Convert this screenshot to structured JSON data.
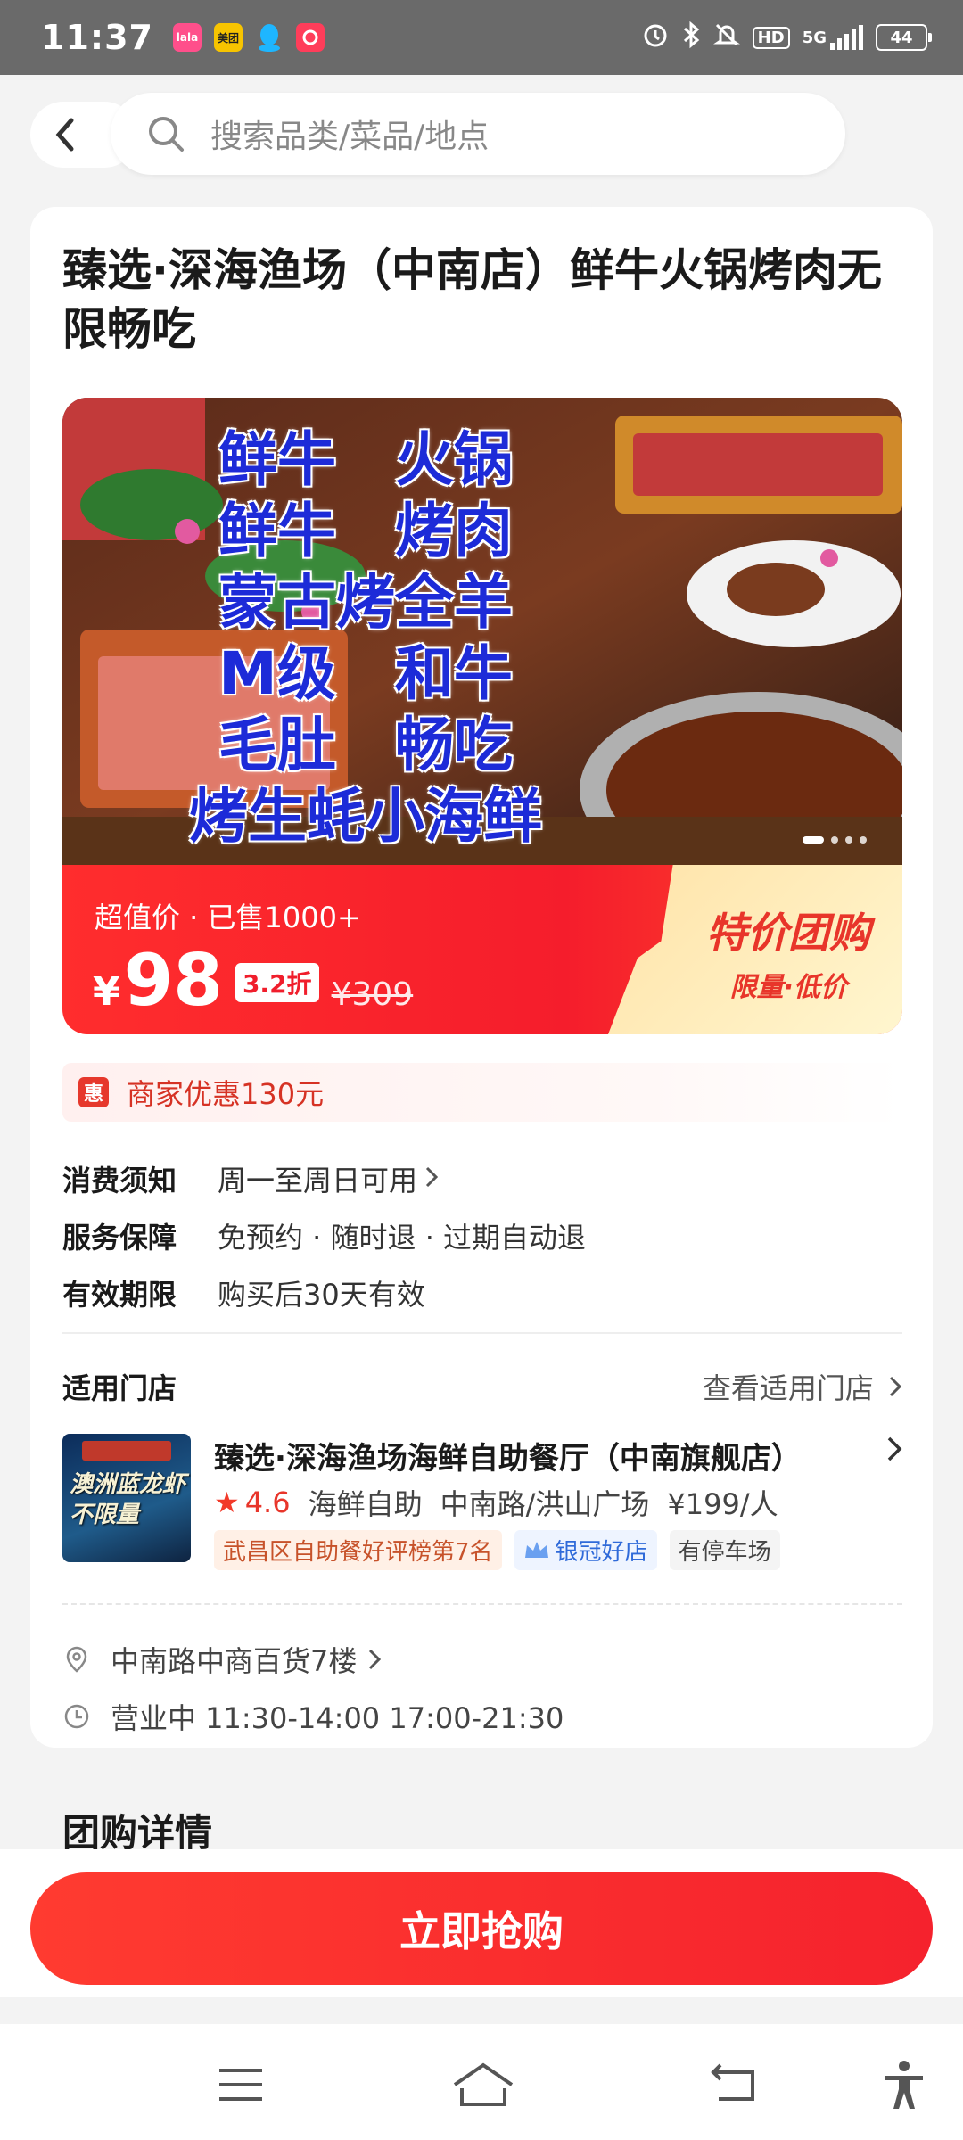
{
  "status_bar": {
    "time": "11:37",
    "notifications": [
      {
        "name": "lala",
        "label": "lala",
        "color": "#ff4f8b"
      },
      {
        "name": "meituan",
        "label": "美团",
        "color": "#f7c400"
      },
      {
        "name": "qq",
        "label": "",
        "color": "#1eb6ff"
      },
      {
        "name": "app",
        "label": "",
        "color": "#ff3d5a"
      }
    ],
    "hd": "HD",
    "network": "5G",
    "battery": "44"
  },
  "search": {
    "placeholder": "搜索品类/菜品/地点"
  },
  "deal": {
    "title": "臻选·深海渔场（中南店）鲜牛火锅烤肉无限畅吃",
    "hero_lines": [
      "鲜牛　火锅",
      "鲜牛　烤肉",
      "蒙古烤全羊",
      "M级　和牛",
      "毛肚　畅吃",
      "烤生蚝小海鲜"
    ],
    "price_tag": "超值价 · 已售1000+",
    "currency": "¥",
    "price": "98",
    "discount": "3.2折",
    "original_price": "¥309",
    "deal_label": "特价团购",
    "deal_sub": "限量·低价",
    "promo": "商家优惠130元",
    "promo_icon": "惠"
  },
  "info": [
    {
      "label": "消费须知",
      "value": "周一至周日可用",
      "has_chevron": true
    },
    {
      "label": "服务保障",
      "value": "免预约 · 随时退 · 过期自动退",
      "has_chevron": false
    },
    {
      "label": "有效期限",
      "value": "购买后30天有效",
      "has_chevron": false
    }
  ],
  "stores": {
    "title": "适用门店",
    "link": "查看适用门店",
    "store": {
      "name": "臻选·深海渔场海鲜自助餐厅（中南旗舰店）",
      "thumb_text": "澳洲蓝龙虾\n不限量",
      "rating": "4.6",
      "category": "海鲜自助",
      "area": "中南路/洪山广场",
      "price_per": "¥199/人",
      "tags": [
        "武昌区自助餐好评榜第7名",
        "银冠好店",
        "有停车场"
      ]
    },
    "address": "中南路中商百货7楼",
    "hours": "营业中 11:30-14:00 17:00-21:30"
  },
  "detail_title": "团购详情",
  "buy_button": "立即抢购",
  "colors": {
    "accent": "#f5222d",
    "promo_text": "#d63224",
    "hero_text": "#1d2bd8"
  }
}
